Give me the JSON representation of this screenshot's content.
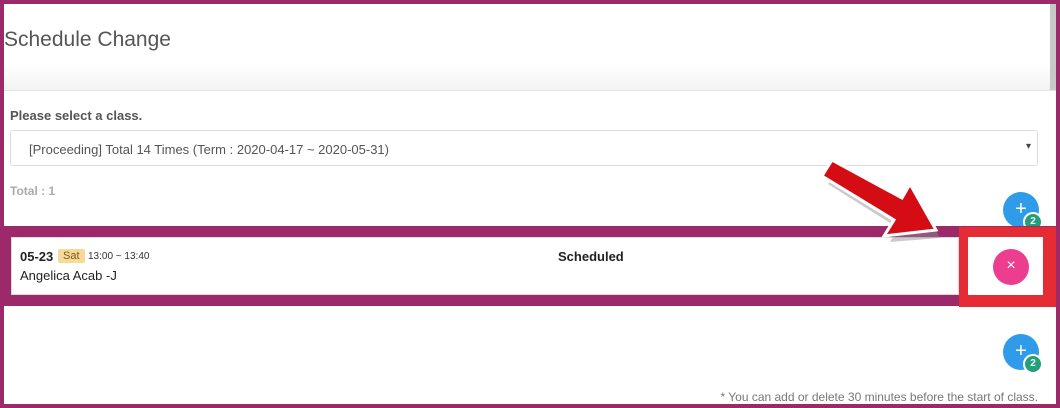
{
  "page": {
    "title": "Schedule Change"
  },
  "class_select": {
    "prompt": "Please select a class.",
    "selected": "[Proceeding] Total 14 Times (Term : 2020-04-17 ~ 2020-05-31)",
    "caret": "▾"
  },
  "total_label": "Total : 1",
  "add_button": {
    "icon": "+",
    "badge": "2"
  },
  "schedule_row": {
    "date": "05-23",
    "day": "Sat",
    "time": "13:00 ~ 13:40",
    "teacher": "Angelica Acab -J",
    "status": "Scheduled"
  },
  "cancel_button": {
    "icon": "×"
  },
  "footnote": "* You can add or delete 30 minutes before the start of class.",
  "colors": {
    "fab": "#2f9be9",
    "cancel": "#ec3d8e",
    "highlight": "#e52c34",
    "frame": "#9c2a6a"
  }
}
